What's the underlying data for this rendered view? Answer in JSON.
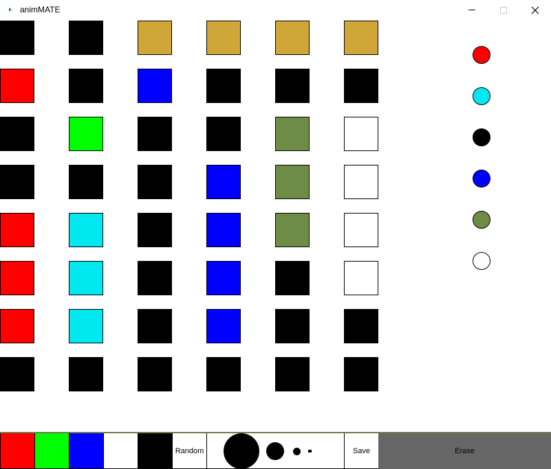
{
  "window": {
    "title": "animMATE"
  },
  "colors": {
    "black": "#000000",
    "gold": "#cfa637",
    "red": "#ff0000",
    "blue": "#0000ff",
    "green": "#00ff00",
    "olive": "#6f8c47",
    "white": "#ffffff",
    "cyan": "#00e8f0",
    "gray": "#666666"
  },
  "grid": [
    [
      "black",
      "black",
      "gold",
      "gold",
      "gold",
      "gold"
    ],
    [
      "red",
      "black",
      "blue",
      "black",
      "black",
      "black"
    ],
    [
      "black",
      "green",
      "black",
      "black",
      "olive",
      "white"
    ],
    [
      "black",
      "black",
      "black",
      "blue",
      "olive",
      "white"
    ],
    [
      "red",
      "cyan",
      "black",
      "blue",
      "olive",
      "white"
    ],
    [
      "red",
      "cyan",
      "black",
      "blue",
      "black",
      "white"
    ],
    [
      "red",
      "cyan",
      "black",
      "blue",
      "black",
      "black"
    ],
    [
      "black",
      "black",
      "black",
      "black",
      "black",
      "black"
    ]
  ],
  "palette": [
    "red",
    "cyan",
    "black",
    "blue",
    "olive",
    "white"
  ],
  "toolbar": {
    "swatches": [
      "red",
      "green",
      "blue",
      "white",
      "black"
    ],
    "random_label": "Random",
    "brush_sizes": [
      "large",
      "medium",
      "small",
      "tiny"
    ],
    "save_label": "Save",
    "erase_label": "Erase"
  }
}
